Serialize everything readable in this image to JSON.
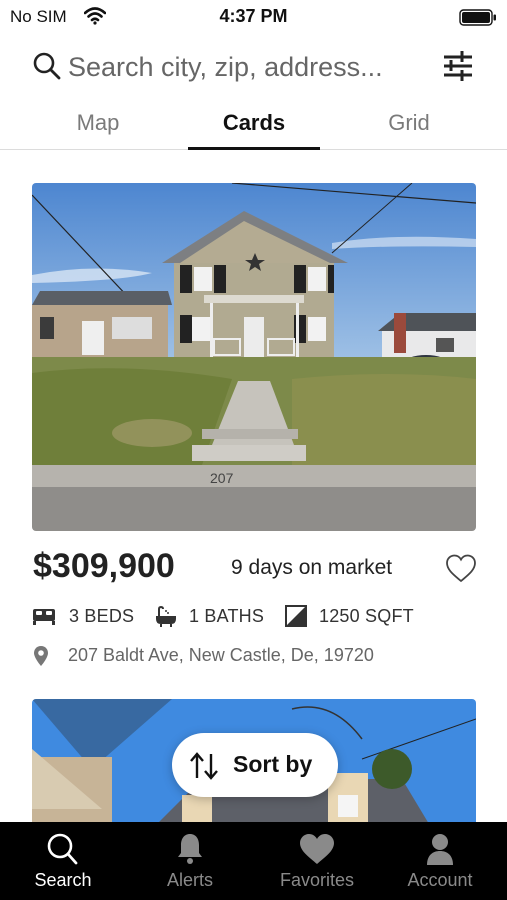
{
  "status_bar": {
    "carrier": "No SIM",
    "time": "4:37 PM"
  },
  "search": {
    "placeholder": "Search city, zip, address..."
  },
  "tabs": [
    {
      "label": "Map",
      "active": false
    },
    {
      "label": "Cards",
      "active": true
    },
    {
      "label": "Grid",
      "active": false
    }
  ],
  "listing": {
    "price": "$309,900",
    "days_on_market": "9 days on market",
    "beds": "3 BEDS",
    "baths": "1 BATHS",
    "sqft": "1250 SQFT",
    "address": "207 Baldt Ave, New Castle, De, 19720",
    "house_number_on_curb": "207",
    "favorited": false
  },
  "sort": {
    "label": "Sort by"
  },
  "bottom_nav": [
    {
      "label": "Search",
      "icon": "search-icon",
      "active": true
    },
    {
      "label": "Alerts",
      "icon": "bell-icon",
      "active": false
    },
    {
      "label": "Favorites",
      "icon": "heart-icon",
      "active": false
    },
    {
      "label": "Account",
      "icon": "person-icon",
      "active": false
    }
  ],
  "colors": {
    "active_tab_underline": "#111111",
    "nav_background": "#000000",
    "nav_active": "#ffffff",
    "nav_inactive": "#8a8a8a"
  }
}
